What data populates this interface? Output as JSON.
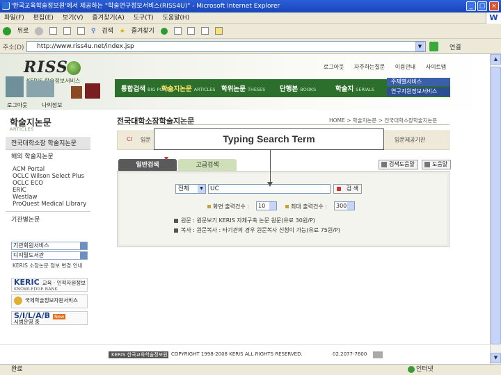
{
  "window": {
    "title": "'한국교육학술정보원'에서 제공하는 \"학술연구정보서비스(RISS4U)\" - Microsoft Internet Explorer",
    "min": "_",
    "max": "□",
    "close": "×",
    "throbber": "W"
  },
  "menubar": {
    "items": [
      "파일(F)",
      "편집(E)",
      "보기(V)",
      "즐겨찾기(A)",
      "도구(T)",
      "도움말(H)"
    ]
  },
  "toolbar": {
    "back": "뒤로",
    "search": "검색",
    "favorites": "즐겨찾기"
  },
  "address": {
    "label": "주소(D)",
    "url": "http://www.riss4u.net/index.jsp",
    "links": "연결"
  },
  "header": {
    "logo": "RISS",
    "logo_sub": "KERIS 학술정보서비스",
    "util_links": [
      "로그아웃",
      "자주하는질문",
      "이용안내",
      "사이트맵"
    ],
    "nav": [
      {
        "label": "통합검색",
        "sub": "BIG PORTAL"
      },
      {
        "label": "학술지논문",
        "sub": "ARTICLES"
      },
      {
        "label": "학위논문",
        "sub": "THESES"
      },
      {
        "label": "단행본",
        "sub": "BOOKS"
      },
      {
        "label": "학술지",
        "sub": "SERIALS"
      }
    ],
    "nav_sub": [
      "주제별서비스",
      "연구지원정보서비스"
    ]
  },
  "login_row": [
    "로그아웃",
    "나의정보"
  ],
  "left_nav": {
    "title": "학술지논문",
    "subtitle": "ARTICLES",
    "bar1": "전국대학소장 학술지논문",
    "bar2": "해외 학술지논문",
    "links": [
      "ACM Portal",
      "OCLC Wilson Select Plus",
      "OCLC ECO",
      "ERIC",
      "Westlaw",
      "ProQuest Medical Library"
    ],
    "inst_title": "기관별논문",
    "inst_selects": [
      "기관회원서비스",
      "디지털도서관"
    ],
    "inst_text": "KERIS 소장논문 정보 변경 안내",
    "banners": [
      {
        "logo": "KERIC",
        "text": "교육 · 인적자원정보",
        "sub": "KNOWLEDGE BANK"
      },
      {
        "logo": "",
        "text": "국제학술정보자원서비스",
        "sub": ""
      },
      {
        "logo": "S/I/L/A/B",
        "text": "시범운영 중",
        "sub": "New"
      }
    ]
  },
  "content": {
    "title": "전국대학소장학술지논문",
    "breadcrumb": "HOME > 학술지논문 > 전국대학소장학술지논문",
    "quick_items": [
      "CI",
      "입문",
      "입문제공기관"
    ],
    "tabs": [
      "일반검색",
      "고급검색"
    ],
    "right_buttons": [
      "검색도움말",
      "도움말"
    ],
    "field_select": "전체",
    "search_value": "UC",
    "search_button": "검 색",
    "options": [
      {
        "label": "화면 출력건수 :",
        "value": "10"
      },
      {
        "label": "최대 출력건수 :",
        "value": "300"
      }
    ],
    "notes": [
      "원문 : 원문보기 KERIS 자체구축 논문 원문(유료 30원/P)",
      "복사 : 원문복사 : 타기관의 경우 원문복사 신청이 가능(유료 75원/P)"
    ]
  },
  "footer": {
    "logo": "KERIS 한국교육학술정보원",
    "text": "COPYRIGHT 1998-2008 KERIS ALL RIGHTS RESERVED.",
    "tel": "02.2077-7600"
  },
  "overlay": {
    "text": "Typing Search Term"
  },
  "status": {
    "left": "완료",
    "zone": "인터넷"
  }
}
